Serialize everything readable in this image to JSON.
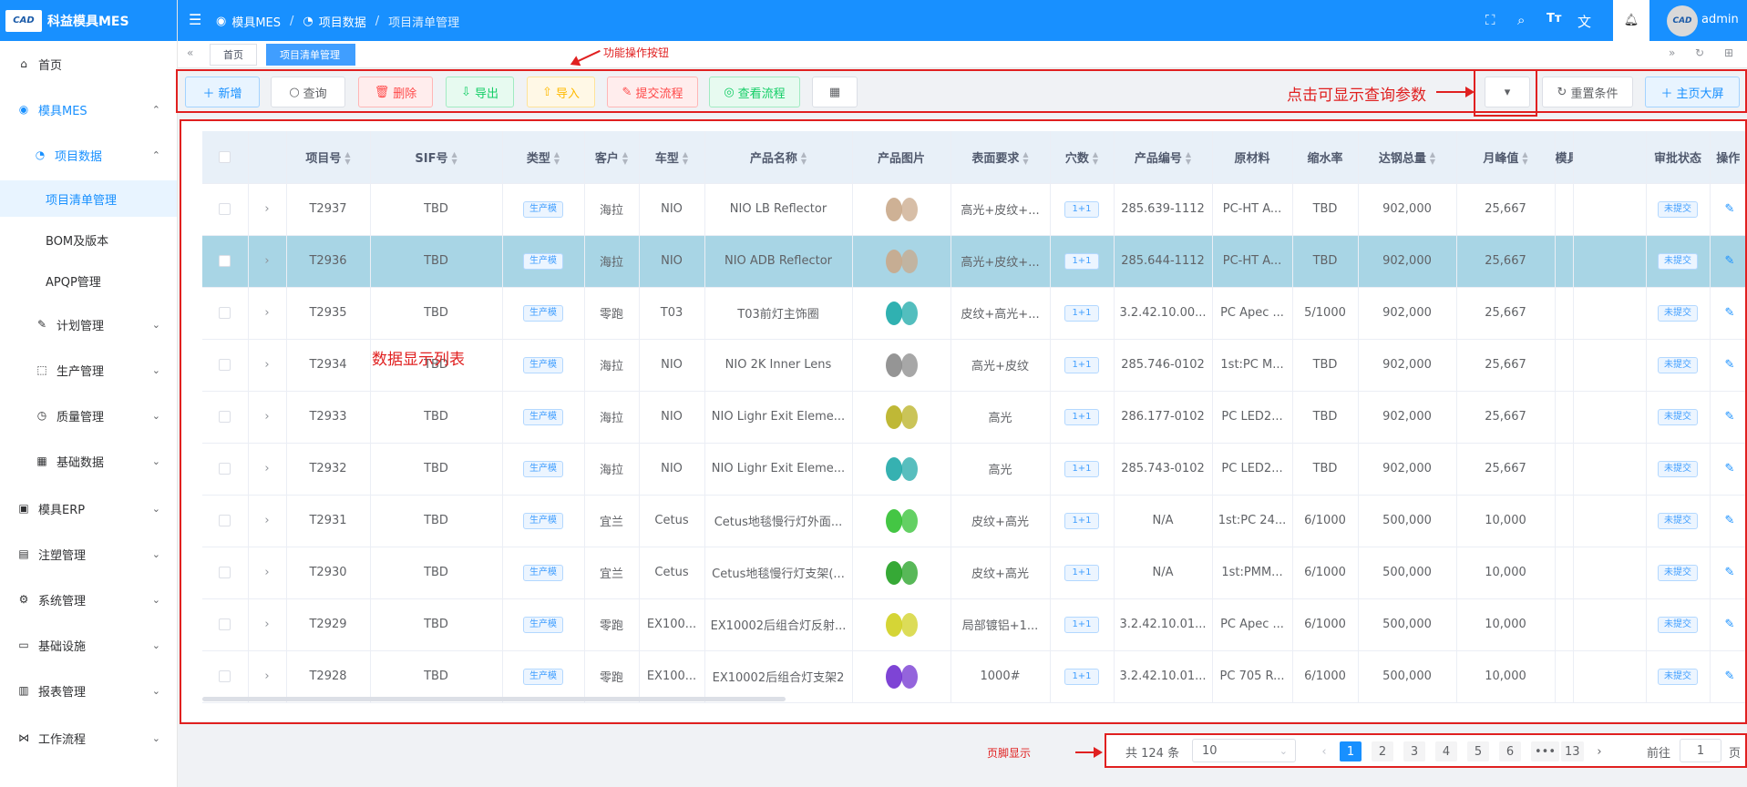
{
  "app": {
    "name": "科益模具MES",
    "logo_text": "CAD"
  },
  "header": {
    "breadcrumb": [
      "模具MES",
      "项目数据",
      "项目清单管理"
    ],
    "user": "admin",
    "icons": [
      "fullscreen-icon",
      "search-icon",
      "font-size-icon",
      "translate-icon",
      "bell-icon"
    ]
  },
  "sidebar": {
    "items": [
      {
        "label": "首页",
        "icon": "home-icon"
      },
      {
        "label": "模具MES",
        "icon": "camera-icon"
      },
      {
        "label": "项目数据",
        "icon": "alarm-icon"
      },
      {
        "label": "项目清单管理"
      },
      {
        "label": "BOM及版本"
      },
      {
        "label": "APQP管理"
      },
      {
        "label": "计划管理",
        "icon": "edit-icon"
      },
      {
        "label": "生产管理",
        "icon": "cube-icon"
      },
      {
        "label": "质量管理",
        "icon": "timer-icon"
      },
      {
        "label": "基础数据",
        "icon": "calendar-icon"
      },
      {
        "label": "模具ERP",
        "icon": "briefcase-icon"
      },
      {
        "label": "注塑管理",
        "icon": "box-icon"
      },
      {
        "label": "系统管理",
        "icon": "gear-icon"
      },
      {
        "label": "基础设施",
        "icon": "monitor-icon"
      },
      {
        "label": "报表管理",
        "icon": "report-icon"
      },
      {
        "label": "工作流程",
        "icon": "workflow-icon"
      }
    ]
  },
  "tabs": [
    {
      "label": "首页"
    },
    {
      "label": "项目清单管理"
    }
  ],
  "toolbar": {
    "add": "新增",
    "query": "查询",
    "delete": "删除",
    "export": "导出",
    "import": "导入",
    "submit": "提交流程",
    "flow": "查看流程",
    "reset": "重置条件",
    "screen": "主页大屏"
  },
  "annotations": {
    "toolbar": "功能操作按钮",
    "query": "点击可显示查询参数",
    "table": "数据显示列表",
    "footer": "页脚显示"
  },
  "table": {
    "columns": [
      "项目号",
      "SIF号",
      "类型",
      "客户",
      "车型",
      "产品名称",
      "产品图片",
      "表面要求",
      "穴数",
      "产品编号",
      "原材料",
      "缩水率",
      "达钢总量",
      "月峰值",
      "模具",
      "审批状态",
      "操作"
    ],
    "rows": [
      {
        "id": "T2937",
        "sif": "TBD",
        "type": "生产模",
        "customer": "海拉",
        "car": "NIO",
        "product": "NIO LB Reflector",
        "surface": "高光+皮纹+...",
        "cavity": "1+1",
        "code": "285.639-1112",
        "material": "PC-HT A...",
        "shrink": "TBD",
        "total": "902,000",
        "peak": "25,667",
        "status": "未提交",
        "img": "#c9a88a"
      },
      {
        "id": "T2936",
        "sif": "TBD",
        "type": "生产模",
        "customer": "海拉",
        "car": "NIO",
        "product": "NIO ADB Reflector",
        "surface": "高光+皮纹+...",
        "cavity": "1+1",
        "code": "285.644-1112",
        "material": "PC-HT A...",
        "shrink": "TBD",
        "total": "902,000",
        "peak": "25,667",
        "status": "未提交",
        "img": "#c9a88a"
      },
      {
        "id": "T2935",
        "sif": "TBD",
        "type": "生产模",
        "customer": "零跑",
        "car": "T03",
        "product": "T03前灯主饰圈",
        "surface": "皮纹+高光+...",
        "cavity": "1+1",
        "code": "3.2.42.10.00...",
        "material": "PC Apec ...",
        "shrink": "5/1000",
        "total": "902,000",
        "peak": "25,667",
        "status": "未提交",
        "img": "#1aa8a8"
      },
      {
        "id": "T2934",
        "sif": "TBD",
        "type": "生产模",
        "customer": "海拉",
        "car": "NIO",
        "product": "NIO 2K Inner Lens",
        "surface": "高光+皮纹",
        "cavity": "1+1",
        "code": "285.746-0102",
        "material": "1st:PC M...",
        "shrink": "TBD",
        "total": "902,000",
        "peak": "25,667",
        "status": "未提交",
        "img": "#8a8a8a"
      },
      {
        "id": "T2933",
        "sif": "TBD",
        "type": "生产模",
        "customer": "海拉",
        "car": "NIO",
        "product": "NIO Lighr Exit Eleme...",
        "surface": "高光",
        "cavity": "1+1",
        "code": "286.177-0102",
        "material": "PC LED2...",
        "shrink": "TBD",
        "total": "902,000",
        "peak": "25,667",
        "status": "未提交",
        "img": "#b8b020"
      },
      {
        "id": "T2932",
        "sif": "TBD",
        "type": "生产模",
        "customer": "海拉",
        "car": "NIO",
        "product": "NIO Lighr Exit Eleme...",
        "surface": "高光",
        "cavity": "1+1",
        "code": "285.743-0102",
        "material": "PC LED2...",
        "shrink": "TBD",
        "total": "902,000",
        "peak": "25,667",
        "status": "未提交",
        "img": "#20a8a8"
      },
      {
        "id": "T2931",
        "sif": "TBD",
        "type": "生产模",
        "customer": "宜兰",
        "car": "Cetus",
        "product": "Cetus地毯慢行灯外面...",
        "surface": "皮纹+高光",
        "cavity": "1+1",
        "code": "N/A",
        "material": "1st:PC 24...",
        "shrink": "6/1000",
        "total": "500,000",
        "peak": "10,000",
        "status": "未提交",
        "img": "#30c030"
      },
      {
        "id": "T2930",
        "sif": "TBD",
        "type": "生产模",
        "customer": "宜兰",
        "car": "Cetus",
        "product": "Cetus地毯慢行灯支架(...",
        "surface": "皮纹+高光",
        "cavity": "1+1",
        "code": "N/A",
        "material": "1st:PMM...",
        "shrink": "6/1000",
        "total": "500,000",
        "peak": "10,000",
        "status": "未提交",
        "img": "#20a020"
      },
      {
        "id": "T2929",
        "sif": "TBD",
        "type": "生产模",
        "customer": "零跑",
        "car": "EX100...",
        "product": "EX10002后组合灯反射...",
        "surface": "局部镀铝+1...",
        "cavity": "1+1",
        "code": "3.2.42.10.01...",
        "material": "PC Apec ...",
        "shrink": "6/1000",
        "total": "500,000",
        "peak": "10,000",
        "status": "未提交",
        "img": "#d0d020"
      },
      {
        "id": "T2928",
        "sif": "TBD",
        "type": "生产模",
        "customer": "零跑",
        "car": "EX100...",
        "product": "EX10002后组合灯支架2",
        "surface": "1000#",
        "cavity": "1+1",
        "code": "3.2.42.10.01...",
        "material": "PC 705 R...",
        "shrink": "6/1000",
        "total": "500,000",
        "peak": "10,000",
        "status": "未提交",
        "img": "#7030d0"
      }
    ]
  },
  "pagination": {
    "total": "共 124 条",
    "page_size": "10",
    "pages": [
      "1",
      "2",
      "3",
      "4",
      "5",
      "6",
      "•••",
      "13"
    ],
    "current_page": 1,
    "goto_label": "前往",
    "goto_value": "1",
    "page_unit": "页"
  },
  "colors": {
    "primary": "#1890ff",
    "annotation": "#e02020",
    "selected_row": "#a8d5e5"
  }
}
